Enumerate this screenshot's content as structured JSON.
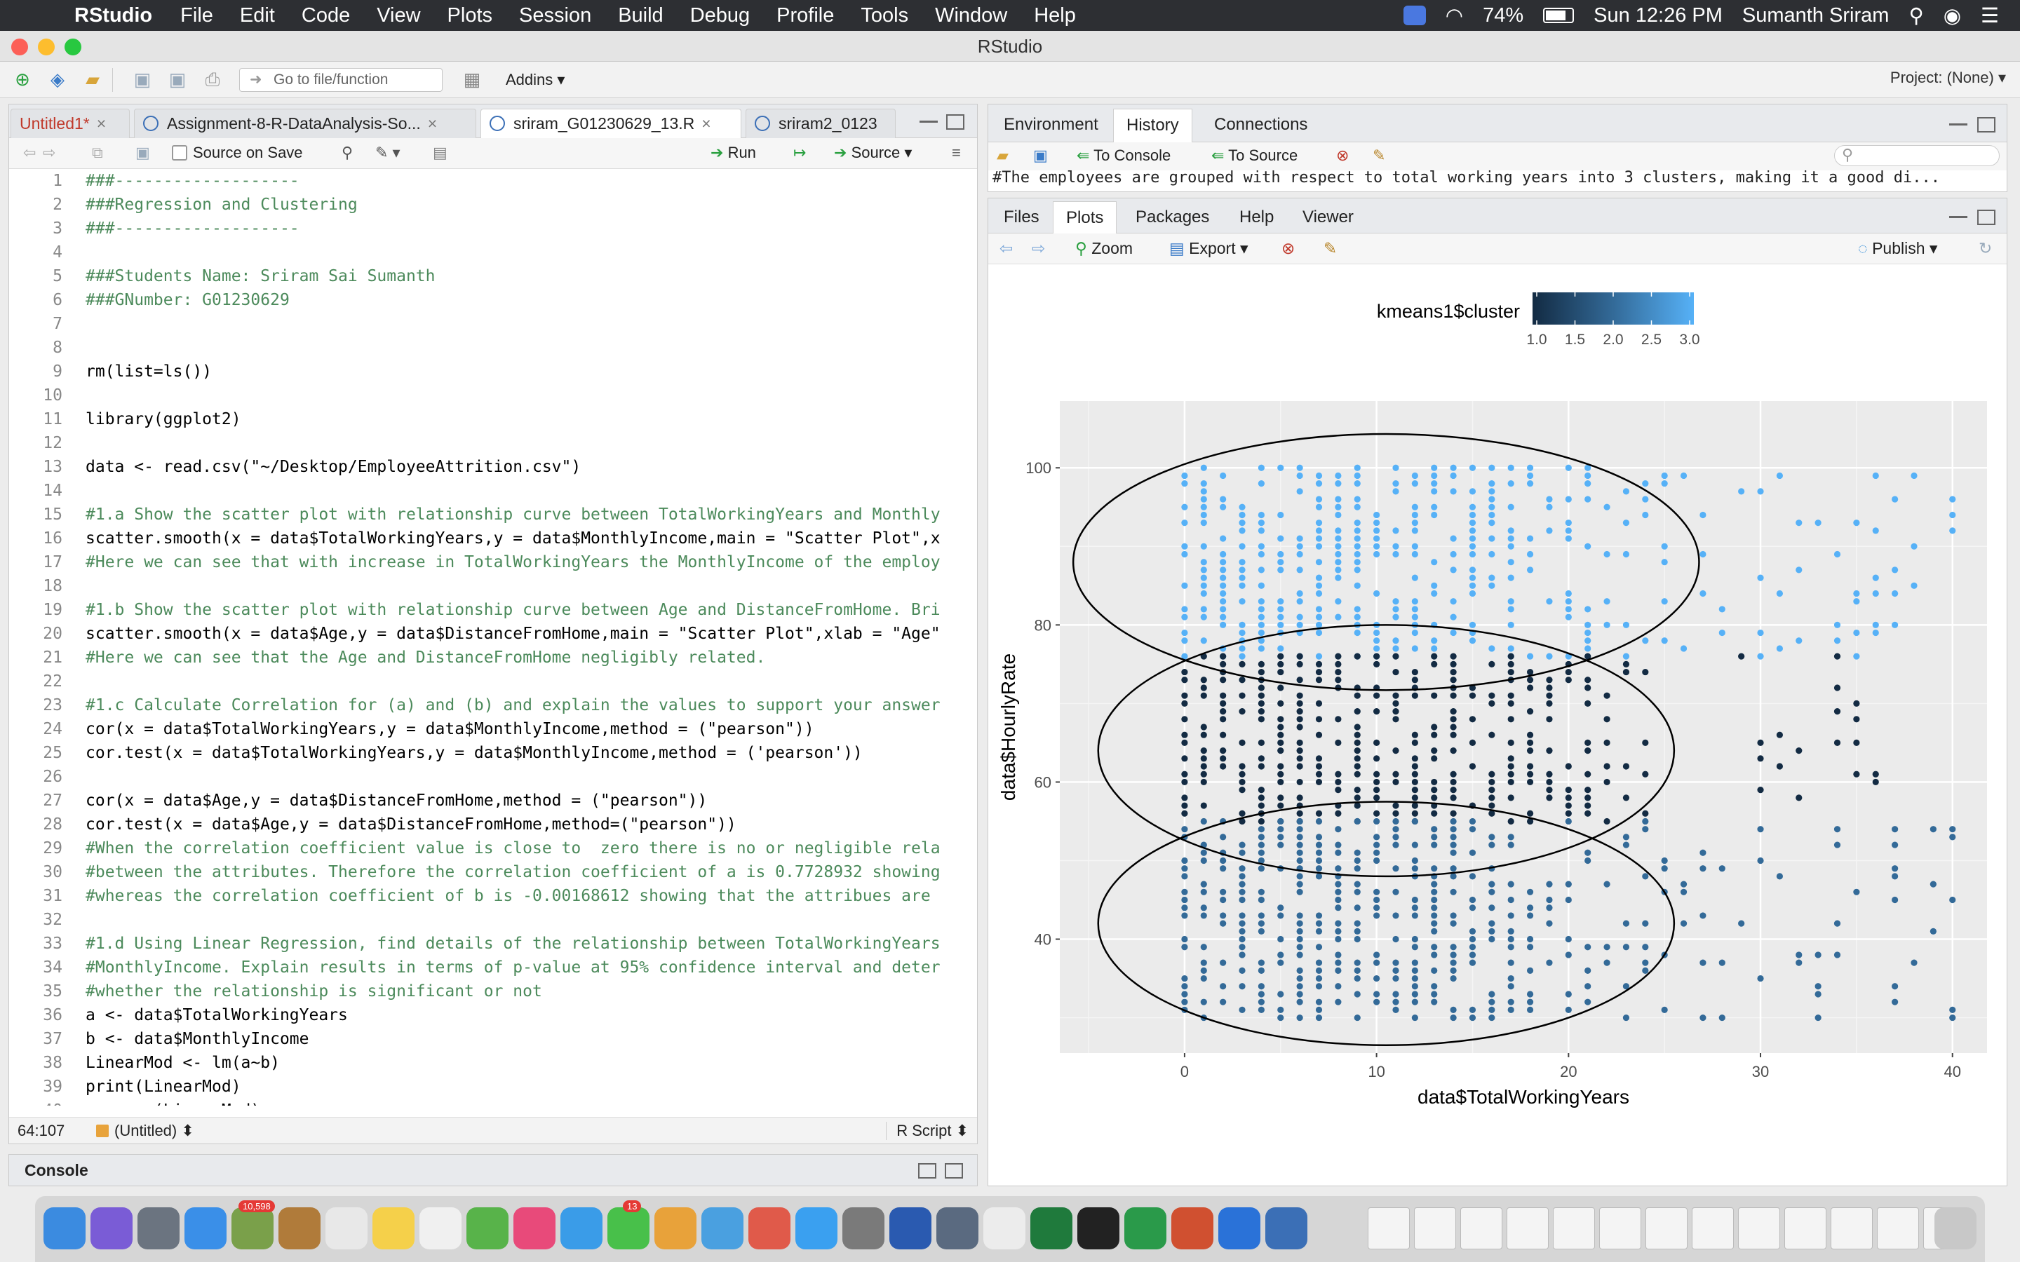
{
  "menubar": {
    "app": "RStudio",
    "menus": [
      "File",
      "Edit",
      "Code",
      "View",
      "Plots",
      "Session",
      "Build",
      "Debug",
      "Profile",
      "Tools",
      "Window",
      "Help"
    ],
    "battery": "74%",
    "clock": "Sun 12:26 PM",
    "user": "Sumanth Sriram"
  },
  "window": {
    "title": "RStudio"
  },
  "toolbar": {
    "goto_placeholder": "Go to file/function",
    "addins": "Addins",
    "project": "Project: (None)"
  },
  "source": {
    "tabs": [
      {
        "label": "Untitled1*",
        "active": false
      },
      {
        "label": "Assignment-8-R-DataAnalysis-So...",
        "active": false
      },
      {
        "label": "sriram_G01230629_13.R",
        "active": true
      },
      {
        "label": "sriram2_0123",
        "active": false
      }
    ],
    "source_on_save": "Source on Save",
    "run": "Run",
    "source_btn": "Source",
    "lines": [
      {
        "n": "1",
        "t": "###-------------------",
        "c": true
      },
      {
        "n": "2",
        "t": "###Regression and Clustering",
        "c": true
      },
      {
        "n": "3",
        "t": "###-------------------",
        "c": true
      },
      {
        "n": "4",
        "t": "",
        "c": false
      },
      {
        "n": "5",
        "t": "###Students Name: Sriram Sai Sumanth",
        "c": true
      },
      {
        "n": "6",
        "t": "###GNumber: G01230629",
        "c": true
      },
      {
        "n": "7",
        "t": "",
        "c": false
      },
      {
        "n": "8",
        "t": "",
        "c": false
      },
      {
        "n": "9",
        "t": "rm(list=ls())",
        "c": false
      },
      {
        "n": "10",
        "t": "",
        "c": false
      },
      {
        "n": "11",
        "t": "library(ggplot2)",
        "c": false
      },
      {
        "n": "12",
        "t": "",
        "c": false
      },
      {
        "n": "13",
        "t": "data <- read.csv(\"~/Desktop/EmployeeAttrition.csv\")",
        "c": false
      },
      {
        "n": "14",
        "t": "",
        "c": false
      },
      {
        "n": "15",
        "t": "#1.a Show the scatter plot with relationship curve between TotalWorkingYears and Monthly",
        "c": true
      },
      {
        "n": "16",
        "t": "scatter.smooth(x = data$TotalWorkingYears,y = data$MonthlyIncome,main = \"Scatter Plot\",x",
        "c": false
      },
      {
        "n": "17",
        "t": "#Here we can see that with increase in TotalWorkingYears the MonthlyIncome of the employ",
        "c": true
      },
      {
        "n": "18",
        "t": "",
        "c": false
      },
      {
        "n": "19",
        "t": "#1.b Show the scatter plot with relationship curve between Age and DistanceFromHome. Bri",
        "c": true
      },
      {
        "n": "20",
        "t": "scatter.smooth(x = data$Age,y = data$DistanceFromHome,main = \"Scatter Plot\",xlab = \"Age\"",
        "c": false
      },
      {
        "n": "21",
        "t": "#Here we can see that the Age and DistanceFromHome negligibly related.",
        "c": true
      },
      {
        "n": "22",
        "t": "",
        "c": false
      },
      {
        "n": "23",
        "t": "#1.c Calculate Correlation for (a) and (b) and explain the values to support your answer",
        "c": true
      },
      {
        "n": "24",
        "t": "cor(x = data$TotalWorkingYears,y = data$MonthlyIncome,method = (\"pearson\"))",
        "c": false
      },
      {
        "n": "25",
        "t": "cor.test(x = data$TotalWorkingYears,y = data$MonthlyIncome,method = ('pearson'))",
        "c": false
      },
      {
        "n": "26",
        "t": "",
        "c": false
      },
      {
        "n": "27",
        "t": "cor(x = data$Age,y = data$DistanceFromHome,method = (\"pearson\"))",
        "c": false
      },
      {
        "n": "28",
        "t": "cor.test(x = data$Age,y = data$DistanceFromHome,method=(\"pearson\"))",
        "c": false
      },
      {
        "n": "29",
        "t": "#When the correlation coefficient value is close to  zero there is no or negligible rela",
        "c": true
      },
      {
        "n": "30",
        "t": "#between the attributes. Therefore the correlation coefficient of a is 0.7728932 showing",
        "c": true
      },
      {
        "n": "31",
        "t": "#whereas the correlation coefficient of b is -0.00168612 showing that the attribues are",
        "c": true
      },
      {
        "n": "32",
        "t": "",
        "c": false
      },
      {
        "n": "33",
        "t": "#1.d Using Linear Regression, find details of the relationship between TotalWorkingYears",
        "c": true
      },
      {
        "n": "34",
        "t": "#MonthlyIncome. Explain results in terms of p-value at 95% confidence interval and deter",
        "c": true
      },
      {
        "n": "35",
        "t": "#whether the relationship is significant or not",
        "c": true
      },
      {
        "n": "36",
        "t": "a <- data$TotalWorkingYears",
        "c": false
      },
      {
        "n": "37",
        "t": "b <- data$MonthlyIncome",
        "c": false
      },
      {
        "n": "38",
        "t": "LinearMod <- lm(a~b)",
        "c": false
      },
      {
        "n": "39",
        "t": "print(LinearMod)",
        "c": false
      },
      {
        "n": "40",
        "t": "summary(LinearMod)",
        "c": false
      }
    ],
    "status_pos": "64:107",
    "status_scope": "(Untitled)",
    "status_type": "R Script"
  },
  "console": {
    "label": "Console"
  },
  "env": {
    "tabs": [
      "Environment",
      "History",
      "Connections"
    ],
    "active_tab": "History",
    "to_console": "To Console",
    "to_source": "To Source",
    "history_line": "#The employees are grouped with respect to total working years into 3 clusters, making it a good di..."
  },
  "plots_pane": {
    "tabs": [
      "Files",
      "Plots",
      "Packages",
      "Help",
      "Viewer"
    ],
    "active_tab": "Plots",
    "zoom": "Zoom",
    "export": "Export",
    "publish": "Publish"
  },
  "chart_data": {
    "type": "scatter",
    "xlabel": "data$TotalWorkingYears",
    "ylabel": "data$HourlyRate",
    "xlim": [
      -6.5,
      41.8
    ],
    "ylim": [
      25.5,
      108.5
    ],
    "xticks": [
      0,
      10,
      20,
      30,
      40
    ],
    "yticks": [
      40,
      60,
      80,
      100
    ],
    "grid": true,
    "legend": {
      "title": "kmeans1$cluster",
      "placement": "top",
      "range": [
        1.0,
        3.0
      ],
      "ticks": [
        "1.0",
        "1.5",
        "2.0",
        "2.5",
        "3.0"
      ]
    },
    "colors": {
      "low": "#132b43",
      "mid": "#336a98",
      "high": "#56b1f7",
      "panel": "#ebebeb",
      "grid": "#ffffff"
    },
    "clusters": [
      {
        "cluster": 3,
        "x_range": [
          0,
          40
        ],
        "y_range": [
          76,
          100
        ]
      },
      {
        "cluster": 1,
        "x_range": [
          0,
          35
        ],
        "y_range": [
          55,
          76
        ]
      },
      {
        "cluster": 2,
        "x_range": [
          0,
          40
        ],
        "y_range": [
          30,
          55
        ]
      }
    ],
    "ellipses": [
      {
        "cx": 10.5,
        "cy": 88,
        "rx": 16.3,
        "ry": 16.3
      },
      {
        "cx": 10.5,
        "cy": 64,
        "rx": 15.0,
        "ry": 16.0
      },
      {
        "cx": 10.5,
        "cy": 42,
        "rx": 15.0,
        "ry": 15.5
      }
    ],
    "outliers": [
      {
        "x": 40,
        "y": 94,
        "cluster": 3
      },
      {
        "x": 40,
        "y": 31,
        "cluster": 2
      },
      {
        "x": 38,
        "y": 37,
        "cluster": 2
      },
      {
        "x": 37,
        "y": 49,
        "cluster": 2
      },
      {
        "x": 37,
        "y": 52,
        "cluster": 2
      },
      {
        "x": 36,
        "y": 61,
        "cluster": 1
      },
      {
        "x": 36,
        "y": 60,
        "cluster": 1
      },
      {
        "x": 37,
        "y": 87,
        "cluster": 3
      },
      {
        "x": 36,
        "y": 99,
        "cluster": 3
      },
      {
        "x": 34,
        "y": 76,
        "cluster": 1
      },
      {
        "x": 35,
        "y": 65,
        "cluster": 1
      }
    ]
  },
  "dock": {
    "badge1": "10,598",
    "badge2": "13"
  }
}
